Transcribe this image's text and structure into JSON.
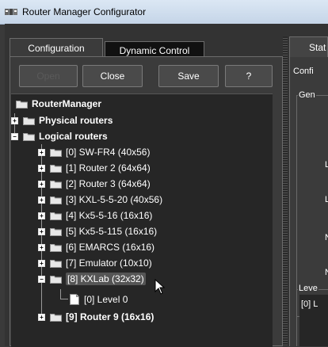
{
  "window": {
    "title": "Router Manager Configurator",
    "icon": "router-manager-app-icon"
  },
  "tabs": [
    {
      "label": "Configuration",
      "active": true
    },
    {
      "label": "Dynamic Control",
      "active": false
    }
  ],
  "toolbar": {
    "open_label": "Open",
    "close_label": "Close",
    "save_label": "Save",
    "help_label": "?"
  },
  "tree": {
    "root": "RouterManager",
    "physical": "Physical routers",
    "logical": "Logical routers",
    "logical_children": [
      "[0] SW-FR4 (40x56)",
      "[1] Router 2 (64x64)",
      "[2] Router 3 (64x64)",
      "[3] KXL-5-5-20 (40x56)",
      "[4] Kx5-5-16 (16x16)",
      "[5] Kx5-5-115 (16x16)",
      "[6] EMARCS (16x16)",
      "[7] Emulator (10x10)",
      "[8] KXLab (32x32)"
    ],
    "level": "[0] Level 0",
    "last": "[9] Router 9 (16x16)",
    "selected": "[8] KXLab (32x32)"
  },
  "right_panel": {
    "tab_label": "Stat",
    "section_label": "Confi",
    "group_label": "Gen",
    "field_letters": [
      "L",
      "L",
      "N",
      "N"
    ],
    "levels_label": "Leve",
    "levels_item": "[0] L"
  },
  "colors": {
    "background": "#3b3b3b",
    "tree_background": "#262626",
    "titlebar": "#c5d5e8"
  }
}
